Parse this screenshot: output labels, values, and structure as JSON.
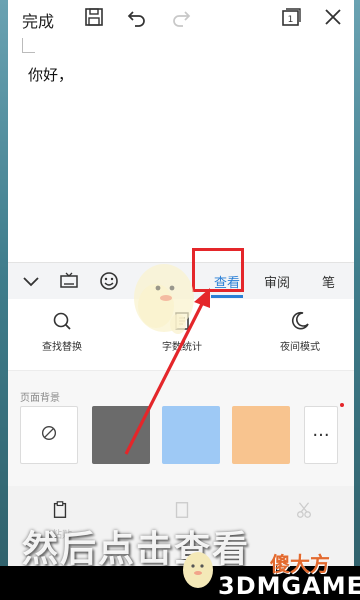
{
  "toolbar": {
    "done_label": "完成",
    "save_icon": "save-icon",
    "undo_icon": "undo-icon",
    "redo_icon": "redo-icon",
    "tabs_icon": "tab-count-icon",
    "tabs_count": "1",
    "close_icon": "close-icon"
  },
  "document": {
    "text": "你好，"
  },
  "mode_tabs": {
    "collapse_icon": "chevron-down-icon",
    "keyboard_icon": "keyboard-icon",
    "emoji_icon": "emoji-icon",
    "items": [
      {
        "label": "查看",
        "active": true
      },
      {
        "label": "审阅",
        "active": false
      },
      {
        "label": "笔",
        "active": false
      }
    ]
  },
  "tools": [
    {
      "label": "查找替换",
      "icon": "search-icon"
    },
    {
      "label": "字数统计",
      "icon": "word-count-icon"
    },
    {
      "label": "夜间模式",
      "icon": "moon-icon"
    }
  ],
  "page_background": {
    "title": "页面背景",
    "swatches": [
      {
        "name": "none",
        "color": "#ffffff"
      },
      {
        "name": "gray",
        "color": "#6b6b6b"
      },
      {
        "name": "blue",
        "color": "#9ec9f5"
      },
      {
        "name": "orange",
        "color": "#f8c48f"
      }
    ],
    "more_label": "···"
  },
  "bottom": {
    "items": [
      "粘贴",
      "",
      ""
    ]
  },
  "overlay": {
    "caption": "然后点击查看",
    "watermark_cn": "傻大方",
    "watermark_en": "3DMGAME",
    "highlight_color": "#e4262a"
  }
}
